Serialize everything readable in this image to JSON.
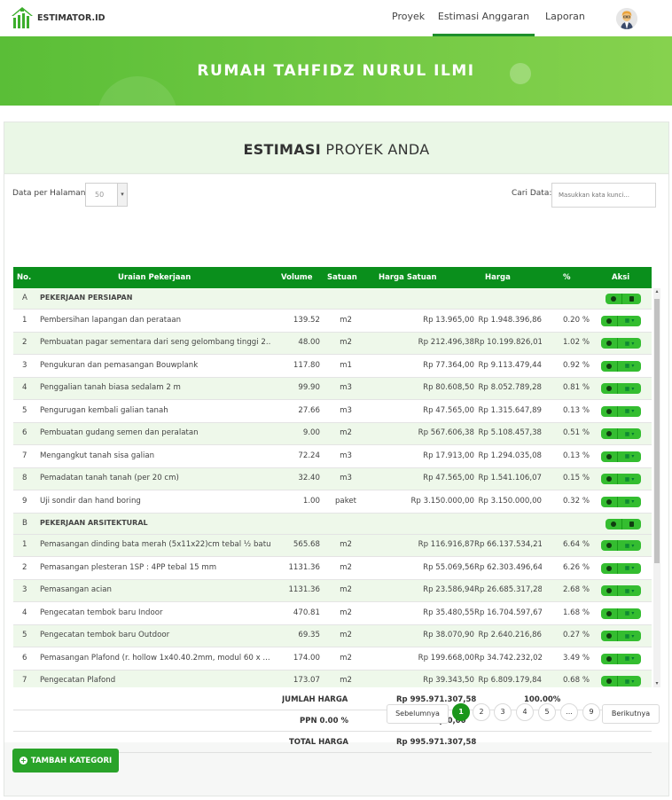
{
  "brand": {
    "name": "ESTIMATOR.ID"
  },
  "nav": {
    "items": [
      "Proyek",
      "Estimasi Anggaran",
      "Laporan"
    ]
  },
  "hero": {
    "title": "RUMAH TAHFIDZ NURUL ILMI"
  },
  "card": {
    "title_bold": "ESTIMASI",
    "title_rest": "PROYEK ANDA"
  },
  "controls": {
    "per_page_label": "Data per Halaman:",
    "per_page_value": "50",
    "search_label": "Cari Data:",
    "search_placeholder": "Masukkan kata kunci..."
  },
  "table": {
    "headers": [
      "No.",
      "Uraian Pekerjaan",
      "Volume",
      "Satuan",
      "Harga Satuan",
      "Harga",
      "%",
      "Aksi"
    ],
    "rows": [
      {
        "kind": "cat",
        "no": "A",
        "desc": "PEKERJAAN PERSIAPAN"
      },
      {
        "kind": "item",
        "no": "1",
        "desc": "Pembersihan lapangan dan perataan",
        "vol": "139.52",
        "sat": "m2",
        "hs": "Rp 13.965,00",
        "harga": "Rp 1.948.396,86",
        "pct": "0.20 %"
      },
      {
        "kind": "item",
        "no": "2",
        "desc": "Pembuatan pagar sementara dari seng gelombang tinggi 2...",
        "vol": "48.00",
        "sat": "m2",
        "hs": "Rp 212.496,38",
        "harga": "Rp 10.199.826,01",
        "pct": "1.02 %"
      },
      {
        "kind": "item",
        "no": "3",
        "desc": "Pengukuran dan pemasangan Bouwplank",
        "vol": "117.80",
        "sat": "m1",
        "hs": "Rp 77.364,00",
        "harga": "Rp 9.113.479,44",
        "pct": "0.92 %"
      },
      {
        "kind": "item",
        "no": "4",
        "desc": "Penggalian tanah biasa sedalam 2 m",
        "vol": "99.90",
        "sat": "m3",
        "hs": "Rp 80.608,50",
        "harga": "Rp 8.052.789,28",
        "pct": "0.81 %"
      },
      {
        "kind": "item",
        "no": "5",
        "desc": "Pengurugan kembali galian tanah",
        "vol": "27.66",
        "sat": "m3",
        "hs": "Rp 47.565,00",
        "harga": "Rp 1.315.647,89",
        "pct": "0.13 %"
      },
      {
        "kind": "item",
        "no": "6",
        "desc": "Pembuatan gudang semen dan peralatan",
        "vol": "9.00",
        "sat": "m2",
        "hs": "Rp 567.606,38",
        "harga": "Rp 5.108.457,38",
        "pct": "0.51 %"
      },
      {
        "kind": "item",
        "no": "7",
        "desc": "Mengangkut tanah sisa galian",
        "vol": "72.24",
        "sat": "m3",
        "hs": "Rp 17.913,00",
        "harga": "Rp 1.294.035,08",
        "pct": "0.13 %"
      },
      {
        "kind": "item",
        "no": "8",
        "desc": "Pemadatan tanah tanah (per 20 cm)",
        "vol": "32.40",
        "sat": "m3",
        "hs": "Rp 47.565,00",
        "harga": "Rp 1.541.106,07",
        "pct": "0.15 %"
      },
      {
        "kind": "item",
        "no": "9",
        "desc": "Uji sondir dan hand boring",
        "vol": "1.00",
        "sat": "paket",
        "hs": "Rp 3.150.000,00",
        "harga": "Rp 3.150.000,00",
        "pct": "0.32 %"
      },
      {
        "kind": "cat",
        "no": "B",
        "desc": "PEKERJAAN ARSITEKTURAL"
      },
      {
        "kind": "item",
        "no": "1",
        "desc": "Pemasangan dinding bata merah (5x11x22)cm tebal ½ batu...",
        "vol": "565.68",
        "sat": "m2",
        "hs": "Rp 116.916,87",
        "harga": "Rp 66.137.534,21",
        "pct": "6.64 %"
      },
      {
        "kind": "item",
        "no": "2",
        "desc": "Pemasangan plesteran 1SP : 4PP tebal 15 mm",
        "vol": "1131.36",
        "sat": "m2",
        "hs": "Rp 55.069,56",
        "harga": "Rp 62.303.496,64",
        "pct": "6.26 %"
      },
      {
        "kind": "item",
        "no": "3",
        "desc": "Pemasangan acian",
        "vol": "1131.36",
        "sat": "m2",
        "hs": "Rp 23.586,94",
        "harga": "Rp 26.685.317,28",
        "pct": "2.68 %"
      },
      {
        "kind": "item",
        "no": "4",
        "desc": "Pengecatan tembok baru Indoor",
        "vol": "470.81",
        "sat": "m2",
        "hs": "Rp 35.480,55",
        "harga": "Rp 16.704.597,67",
        "pct": "1.68 %"
      },
      {
        "kind": "item",
        "no": "5",
        "desc": "Pengecatan tembok baru Outdoor",
        "vol": "69.35",
        "sat": "m2",
        "hs": "Rp 38.070,90",
        "harga": "Rp 2.640.216,86",
        "pct": "0.27 %"
      },
      {
        "kind": "item",
        "no": "6",
        "desc": "Pemasangan Plafond (r. hollow 1x40.40.2mm, modul 60 x ...",
        "vol": "174.00",
        "sat": "m2",
        "hs": "Rp 199.668,00",
        "harga": "Rp 34.742.232,02",
        "pct": "3.49 %"
      },
      {
        "kind": "item",
        "no": "7",
        "desc": "Pengecatan Plafond",
        "vol": "173.07",
        "sat": "m2",
        "hs": "Rp 39.343,50",
        "harga": "Rp 6.809.179,84",
        "pct": "0.68 %"
      }
    ]
  },
  "totals": [
    {
      "label": "JUMLAH HARGA",
      "value": "Rp 995.971.307,58",
      "pct": "100.00%"
    },
    {
      "label": "PPN 0.00 %",
      "value": "Rp 0,00",
      "pct": ""
    },
    {
      "label": "TOTAL HARGA",
      "value": "Rp 995.971.307,58",
      "pct": ""
    }
  ],
  "pagination": {
    "prev": "Sebelumnya",
    "next": "Berikutnya",
    "pages": [
      "1",
      "2",
      "3",
      "4",
      "5",
      "...",
      "9"
    ],
    "current": "1"
  },
  "add_category": {
    "label": "TAMBAH KATEGORI"
  }
}
